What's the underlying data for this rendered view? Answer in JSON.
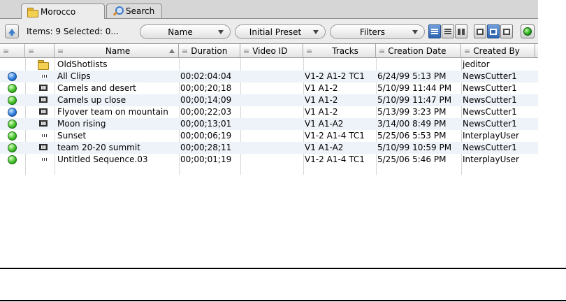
{
  "tabs": [
    {
      "label": "Morocco",
      "icon": "folder-icon",
      "active": true
    },
    {
      "label": "Search",
      "icon": "search-icon",
      "active": false
    }
  ],
  "toolbar": {
    "items_status": "Items: 9 Selected: 0...",
    "sort_dropdown": "Name",
    "preset_dropdown": "Initial Preset",
    "filters_dropdown": "Filters"
  },
  "columns": {
    "c1": "",
    "c2": "",
    "name": "Name",
    "duration": "Duration",
    "video_id": "Video ID",
    "tracks": "Tracks",
    "creation_date": "Creation Date",
    "created_by": "Created By"
  },
  "rows": [
    {
      "status": "",
      "type": "folder",
      "name": "OldShotlists",
      "duration": "",
      "video_id": "",
      "tracks": "",
      "creation_date": "",
      "created_by": "jeditor"
    },
    {
      "status": "blue",
      "type": "sequence",
      "name": "All Clips",
      "duration": "00:02:04:04",
      "video_id": "",
      "tracks": "V1-2 A1-2 TC1",
      "creation_date": "6/24/99 5:13 PM",
      "created_by": "NewsCutter1"
    },
    {
      "status": "green",
      "type": "clip",
      "name": "Camels and desert",
      "duration": "00;00;20;18",
      "video_id": "",
      "tracks": "V1 A1-2",
      "creation_date": "5/10/99 11:44 PM",
      "created_by": "NewsCutter1"
    },
    {
      "status": "green",
      "type": "clip",
      "name": "Camels up close",
      "duration": "00;00;14;09",
      "video_id": "",
      "tracks": "V1 A1-2",
      "creation_date": "5/10/99 11:47 PM",
      "created_by": "NewsCutter1"
    },
    {
      "status": "blue",
      "type": "clip",
      "name": "Flyover team on mountain",
      "duration": "00;00;22;03",
      "video_id": "",
      "tracks": "V1 A1-2",
      "creation_date": "5/13/99 3:23 PM",
      "created_by": "NewsCutter1"
    },
    {
      "status": "green",
      "type": "clip",
      "name": "Moon rising",
      "duration": "00;00;13;01",
      "video_id": "",
      "tracks": "V1 A1-A2",
      "creation_date": "3/14/00 8:49 PM",
      "created_by": "NewsCutter1"
    },
    {
      "status": "green",
      "type": "sequence",
      "name": "Sunset",
      "duration": "00;00;06;19",
      "video_id": "",
      "tracks": "V1-2 A1-4 TC1",
      "creation_date": "5/25/06 5:53 PM",
      "created_by": "InterplayUser"
    },
    {
      "status": "green",
      "type": "clip",
      "name": "team 20-20 summit",
      "duration": "00;00;28;11",
      "video_id": "",
      "tracks": "V1 A1-A2",
      "creation_date": "5/10/99 10:59 PM",
      "created_by": "NewsCutter1"
    },
    {
      "status": "green",
      "type": "sequence",
      "name": "Untitled Sequence.03",
      "duration": "00;00;01;19",
      "video_id": "",
      "tracks": "V1-2 A1-4 TC1",
      "creation_date": "5/25/06 5:46 PM",
      "created_by": "InterplayUser"
    }
  ]
}
